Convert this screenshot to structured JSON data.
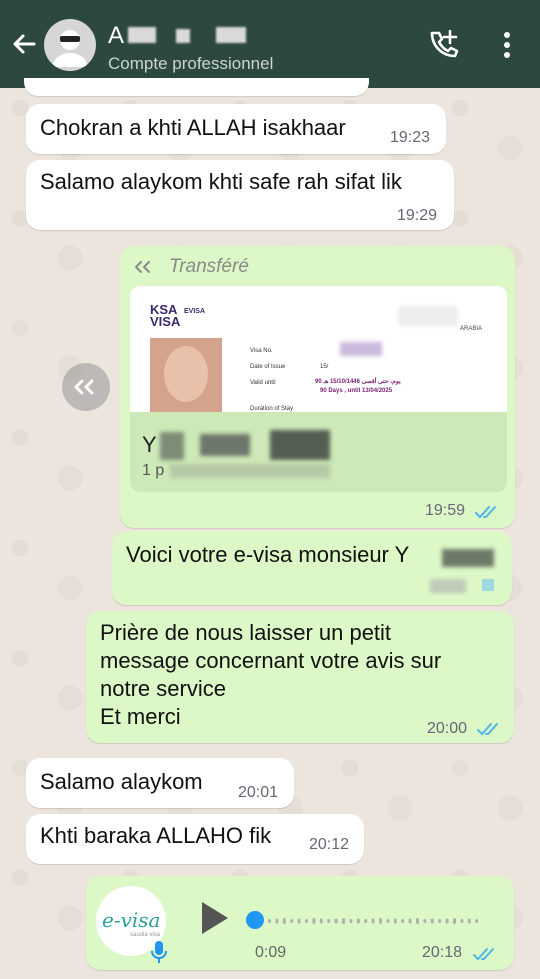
{
  "header": {
    "contact_name": "A",
    "subtitle": "Compte professionnel"
  },
  "messages": [
    {
      "text": "Chokran a khti ALLAH isakhaar",
      "time": "19:23"
    },
    {
      "text": "Salamo alaykom khti safe rah sifat lik",
      "time": "19:29"
    },
    {
      "forwarded_label": "Transféré",
      "time": "19:59",
      "visa": {
        "brand": "KSA",
        "brand2": "VISA",
        "evisa": "EVISA",
        "arabia": "ARABIA",
        "visa_no": "Visa No.",
        "date_issue": "Date of Issue",
        "valid_until": "Valid until",
        "duration": "Duration of Stay",
        "valid_line": "90 يوم، حتى أقصى 15/10/1446 هـ",
        "valid_line2": "90 Days , until 13/04/2025",
        "issue_partial": "15/"
      },
      "caption_line1": "Y",
      "caption_line2": "1 p"
    },
    {
      "text": "Voici votre e-visa monsieur Y",
      "time": ""
    },
    {
      "text": "Prière de nous laisser un petit\nmessage concernant votre avis sur\nnotre service\nEt merci",
      "time": "20:00"
    },
    {
      "text": "Salamo alaykom",
      "time": "20:01"
    },
    {
      "text": "Khti baraka ALLAHO fik",
      "time": "20:12"
    },
    {
      "voice_duration": "0:09",
      "time": "20:18",
      "logo_text": "e-visa",
      "logo_sub": "saudia visa"
    }
  ]
}
